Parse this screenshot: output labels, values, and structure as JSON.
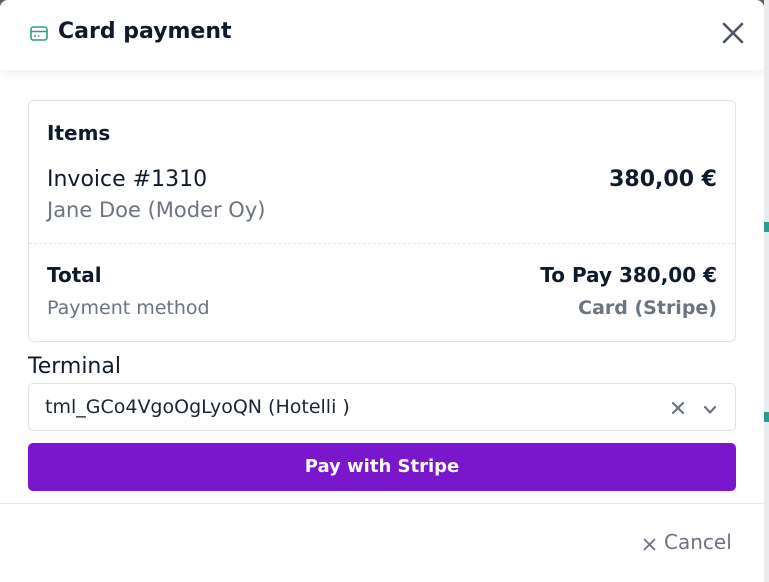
{
  "modal": {
    "title": "Card payment",
    "header_icon": "credit-card-icon",
    "close_icon": "close-icon"
  },
  "items": {
    "heading": "Items",
    "invoice_title": "Invoice #1310",
    "customer": "Jane Doe (Moder Oy)",
    "amount": "380,00 €"
  },
  "summary": {
    "total_label": "Total",
    "total_value": "To Pay 380,00 €",
    "method_label": "Payment method",
    "method_value": "Card (Stripe)"
  },
  "terminal": {
    "label": "Terminal",
    "selected_value": "tml_GCo4VgoOgLyoQN (Hotelli )",
    "clear_icon": "clear-icon",
    "dropdown_icon": "chevron-down-icon"
  },
  "actions": {
    "pay_label": "Pay with Stripe",
    "cancel_label": "Cancel",
    "cancel_icon": "close-icon"
  },
  "colors": {
    "accent": "#7a16cc",
    "icon_teal": "#2a9d8f",
    "text_dark": "#0f1b2a",
    "text_muted": "#6c7480"
  }
}
